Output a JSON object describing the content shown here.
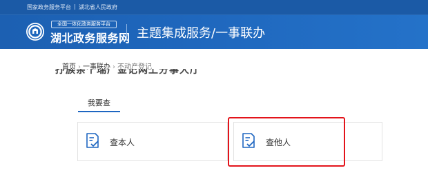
{
  "topbar": {
    "links": [
      "国家政务服务平台",
      "湖北省人民政府"
    ]
  },
  "header": {
    "logo_tag": "全国一体化政务服务平台",
    "logo_name": "湖北政务服务网",
    "title": "主题集成服务/一事联办"
  },
  "breadcrumb": {
    "items": [
      "首页",
      "一事联办",
      "不动产登记"
    ]
  },
  "section": {
    "heading_clipped": "抒族亲个瑞广金记网上分事大厅"
  },
  "tabs": [
    {
      "label": "我要查",
      "active": true
    }
  ],
  "cards": [
    {
      "label": "查本人",
      "icon": "form-check-icon"
    },
    {
      "label": "查他人",
      "icon": "form-check-icon",
      "highlighted": true
    }
  ],
  "colors": {
    "brand_blue": "#1f67bd",
    "topbar_blue": "#1b5aa6",
    "tab_accent": "#1e66c1",
    "icon_blue": "#1e66c1",
    "highlight_red": "#e3131a"
  }
}
